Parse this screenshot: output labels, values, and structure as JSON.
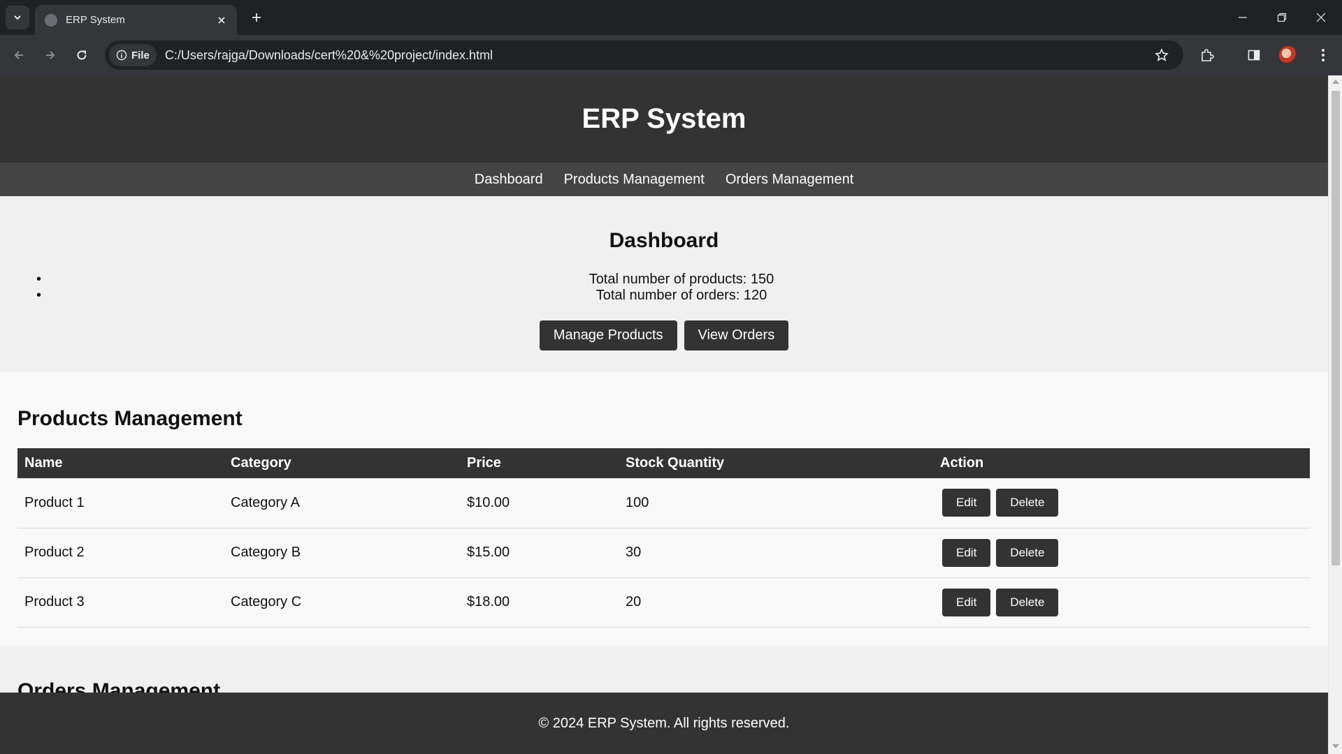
{
  "browser": {
    "tab_title": "ERP System",
    "url_chip": "File",
    "url": "C:/Users/rajga/Downloads/cert%20&%20project/index.html"
  },
  "site": {
    "title": "ERP System",
    "nav": [
      "Dashboard",
      "Products Management",
      "Orders Management"
    ]
  },
  "dashboard": {
    "heading": "Dashboard",
    "stats": [
      "Total number of products: 150",
      "Total number of orders: 120"
    ],
    "buttons": [
      "Manage Products",
      "View Orders"
    ]
  },
  "products": {
    "heading": "Products Management",
    "columns": [
      "Name",
      "Category",
      "Price",
      "Stock Quantity",
      "Action"
    ],
    "rows": [
      {
        "name": "Product 1",
        "category": "Category A",
        "price": "$10.00",
        "stock": "100"
      },
      {
        "name": "Product 2",
        "category": "Category B",
        "price": "$15.00",
        "stock": "30"
      },
      {
        "name": "Product 3",
        "category": "Category C",
        "price": "$18.00",
        "stock": "20"
      }
    ],
    "edit_label": "Edit",
    "delete_label": "Delete"
  },
  "orders": {
    "heading": "Orders Management"
  },
  "footer": {
    "text": "© 2024 ERP System. All rights reserved."
  }
}
